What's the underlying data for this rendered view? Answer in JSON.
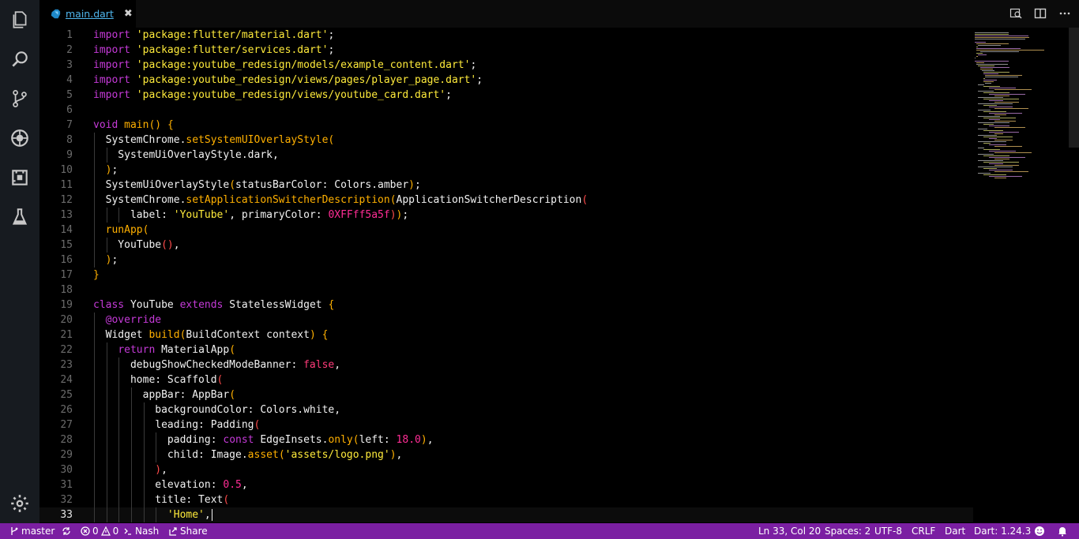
{
  "tab": {
    "filename": "main.dart",
    "close_glyph": "✖"
  },
  "activity": [
    "explorer-icon",
    "search-icon",
    "source-control-icon",
    "debug-icon",
    "extensions-icon",
    "test-flask-icon",
    "settings-gear-icon"
  ],
  "editor": {
    "current_line": 33,
    "lines": [
      {
        "n": "1",
        "t": "<span class=\"k\">import</span> <span class=\"s\">'package:flutter/material.dart'</span>;"
      },
      {
        "n": "2",
        "t": "<span class=\"k\">import</span> <span class=\"s\">'package:flutter/services.dart'</span>;"
      },
      {
        "n": "3",
        "t": "<span class=\"k\">import</span> <span class=\"s\">'package:youtube_redesign/models/example_content.dart'</span>;"
      },
      {
        "n": "4",
        "t": "<span class=\"k\">import</span> <span class=\"s\">'package:youtube_redesign/views/pages/player_page.dart'</span>;"
      },
      {
        "n": "5",
        "t": "<span class=\"k\">import</span> <span class=\"s\">'package:youtube_redesign/views/youtube_card.dart'</span>;"
      },
      {
        "n": "6",
        "t": ""
      },
      {
        "n": "7",
        "t": "<span class=\"k\">void</span> <span class=\"f\">main</span><span class=\"p\">()</span> <span class=\"p\">{</span>"
      },
      {
        "n": "8",
        "t": "  SystemChrome.<span class=\"f\">setSystemUIOverlayStyle</span><span class=\"p\">(</span>"
      },
      {
        "n": "9",
        "t": "    SystemUiOverlayStyle.dark,"
      },
      {
        "n": "10",
        "t": "  <span class=\"p\">)</span>;"
      },
      {
        "n": "11",
        "t": "  SystemUiOverlayStyle<span class=\"p\">(</span>statusBarColor: Colors.amber<span class=\"p\">)</span>;"
      },
      {
        "n": "12",
        "t": "  SystemChrome.<span class=\"f\">setApplicationSwitcherDescription</span><span class=\"p\">(</span>ApplicationSwitcherDescription<span class=\"pr\">(</span>"
      },
      {
        "n": "13",
        "t": "      label: <span class=\"s\">'YouTube'</span>, primaryColor: <span class=\"c\">0XFFff5a5f</span><span class=\"pr\">)</span><span class=\"p\">)</span>;"
      },
      {
        "n": "14",
        "t": "  <span class=\"f\">runApp</span><span class=\"p\">(</span>"
      },
      {
        "n": "15",
        "t": "    YouTube<span class=\"pr\">()</span>,"
      },
      {
        "n": "16",
        "t": "  <span class=\"p\">)</span>;"
      },
      {
        "n": "17",
        "t": "<span class=\"p\">}</span>"
      },
      {
        "n": "18",
        "t": ""
      },
      {
        "n": "19",
        "t": "<span class=\"k\">class</span> YouTube <span class=\"k\">extends</span> StatelessWidget <span class=\"p\">{</span>"
      },
      {
        "n": "20",
        "t": "  <span class=\"k\">@override</span>"
      },
      {
        "n": "21",
        "t": "  Widget <span class=\"f\">build</span><span class=\"p\">(</span>BuildContext context<span class=\"p\">)</span> <span class=\"p\">{</span>"
      },
      {
        "n": "22",
        "t": "    <span class=\"k\">return</span> MaterialApp<span class=\"p\">(</span>"
      },
      {
        "n": "23",
        "t": "      debugShowCheckedModeBanner: <span class=\"n\">false</span>,"
      },
      {
        "n": "24",
        "t": "      home: Scaffold<span class=\"pr\">(</span>"
      },
      {
        "n": "25",
        "t": "        appBar: AppBar<span class=\"p\">(</span>"
      },
      {
        "n": "26",
        "t": "          backgroundColor: Colors.white,"
      },
      {
        "n": "27",
        "t": "          leading: Padding<span class=\"pr\">(</span>"
      },
      {
        "n": "28",
        "t": "            padding: <span class=\"k\">const</span> EdgeInsets.<span class=\"f\">only</span><span class=\"p\">(</span>left: <span class=\"c\">18.0</span><span class=\"p\">)</span>,"
      },
      {
        "n": "29",
        "t": "            child: Image.<span class=\"f\">asset</span><span class=\"p\">(</span><span class=\"s\">'assets/logo.png'</span><span class=\"p\">)</span>,"
      },
      {
        "n": "30",
        "t": "          <span class=\"pr\">)</span>,"
      },
      {
        "n": "31",
        "t": "          elevation: <span class=\"c\">0.5</span>,"
      },
      {
        "n": "32",
        "t": "          title: Text<span class=\"pr\">(</span>"
      },
      {
        "n": "33",
        "t": "            <span class=\"s\">'Home'</span>,<span class=\"cursor\"></span>"
      }
    ]
  },
  "status": {
    "branch": "master",
    "errors": "0",
    "warnings": "0",
    "shell": "Nash",
    "share": "Share",
    "position": "Ln 33, Col 20",
    "spaces": "Spaces: 2",
    "encoding": "UTF-8",
    "eol": "CRLF",
    "language": "Dart",
    "sdk": "Dart: 1.24.3"
  },
  "colors": {
    "accent": "#7b1fa2",
    "tab_text": "#4fb6ee",
    "keyword": "#c53ad8",
    "string": "#ffeb3b",
    "function": "#ffb000",
    "literal": "#ff2d95"
  }
}
